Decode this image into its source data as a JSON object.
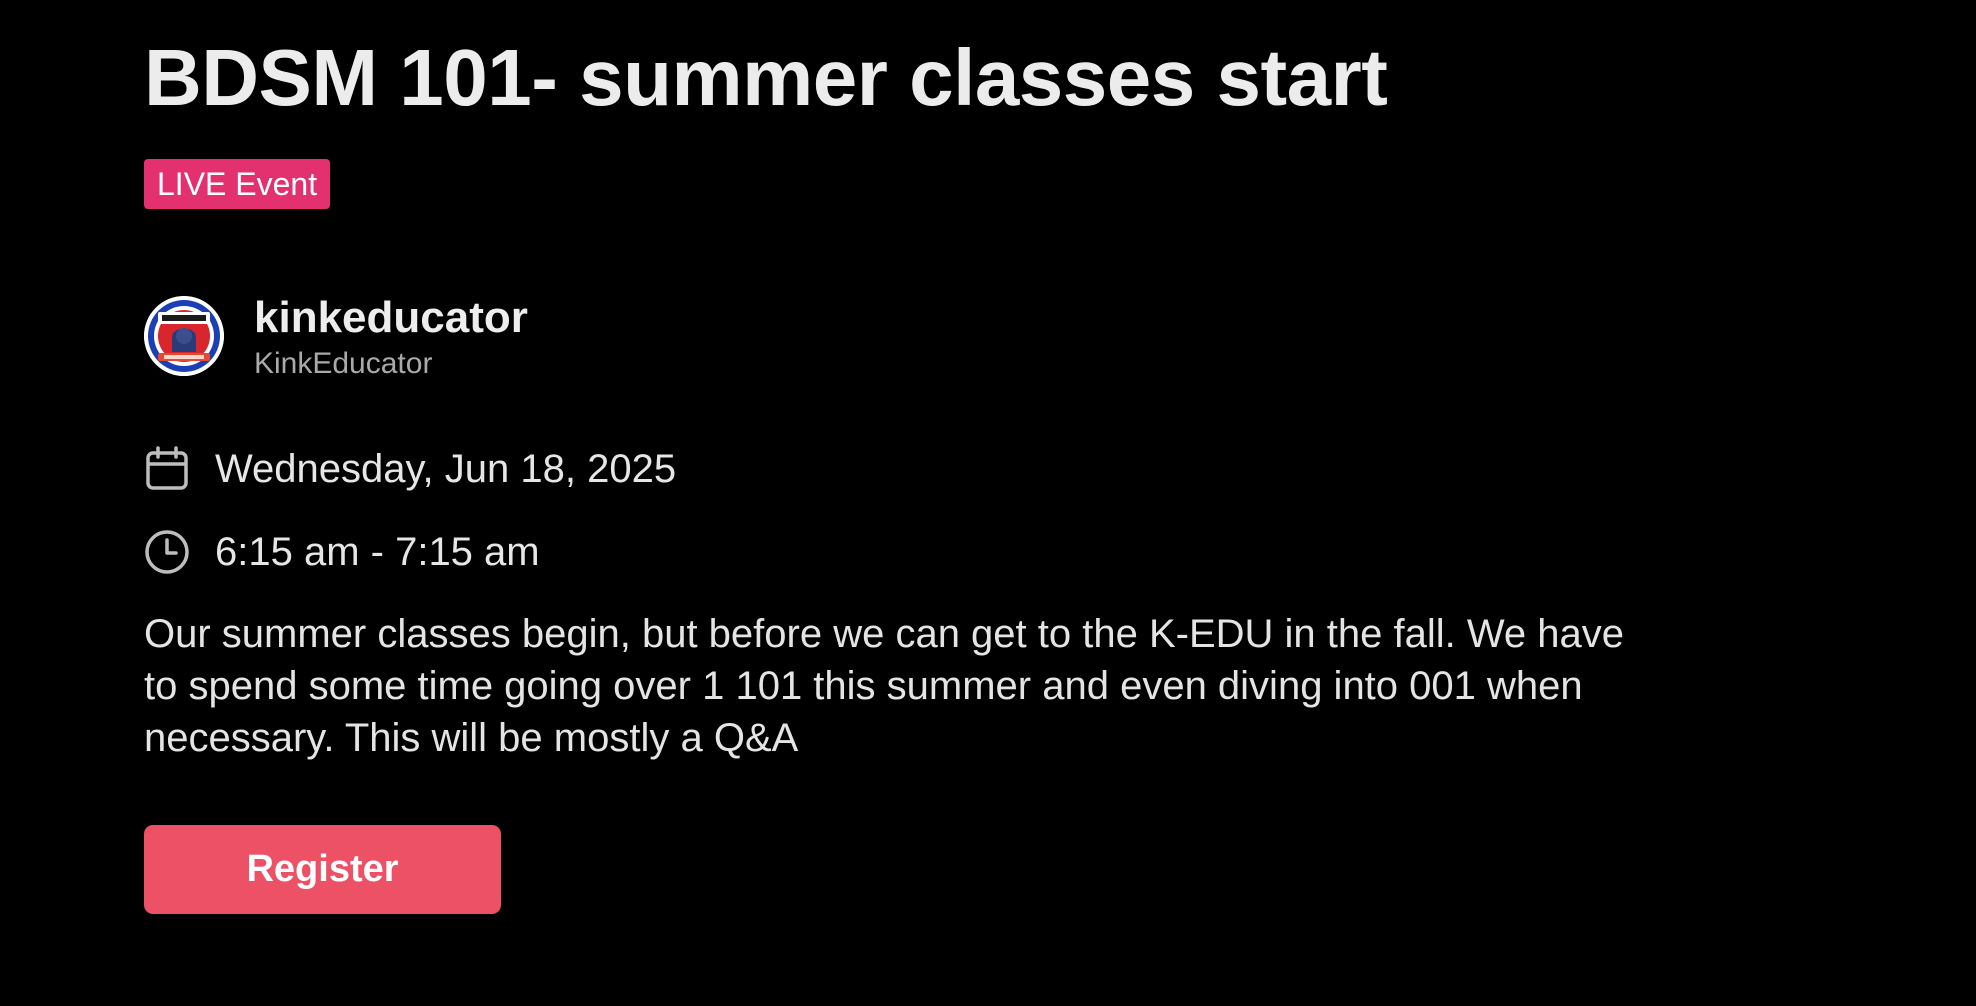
{
  "event": {
    "title": "BDSM 101- summer classes start",
    "badge": "LIVE Event",
    "badge_color": "#e3316f"
  },
  "host": {
    "name": "kinkeducator",
    "handle": "KinkEducator",
    "avatar_icon": "profile-avatar-logo"
  },
  "schedule": {
    "date_icon": "calendar-icon",
    "date": "Wednesday, Jun 18, 2025",
    "time_icon": "clock-icon",
    "time": "6:15 am - 7:15 am"
  },
  "description": "Our summer classes begin, but before we can get to the K-EDU in the fall. We have to spend some time going over 1 101 this summer and even diving into 001 when necessary. This will be mostly a Q&A",
  "actions": {
    "register_label": "Register",
    "register_color": "#ec5166"
  },
  "theme": {
    "background": "#000000",
    "text": "#e8e8e8",
    "muted_text": "#a9a9a9"
  }
}
